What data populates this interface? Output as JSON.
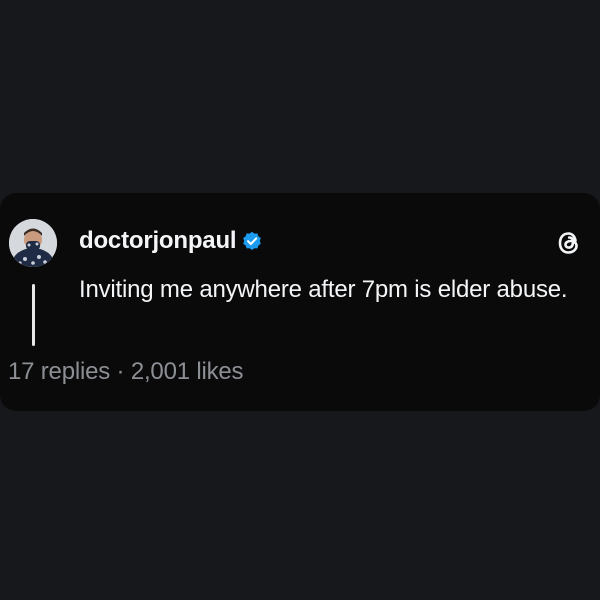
{
  "post": {
    "username": "doctorjonpaul",
    "verified": true,
    "text": "Inviting me anywhere after 7pm is elder abuse.",
    "replies": "17 replies",
    "separator": "·",
    "likes": "2,001 likes"
  },
  "icons": {
    "avatar": "profile-photo",
    "verified": "verified-badge-icon",
    "logo": "threads-logo-icon"
  },
  "colors": {
    "background": "#17181c",
    "card": "#0a0a0b",
    "text": "#f3f5f7",
    "muted": "#8c8f94",
    "verified": "#1d9bf0"
  }
}
